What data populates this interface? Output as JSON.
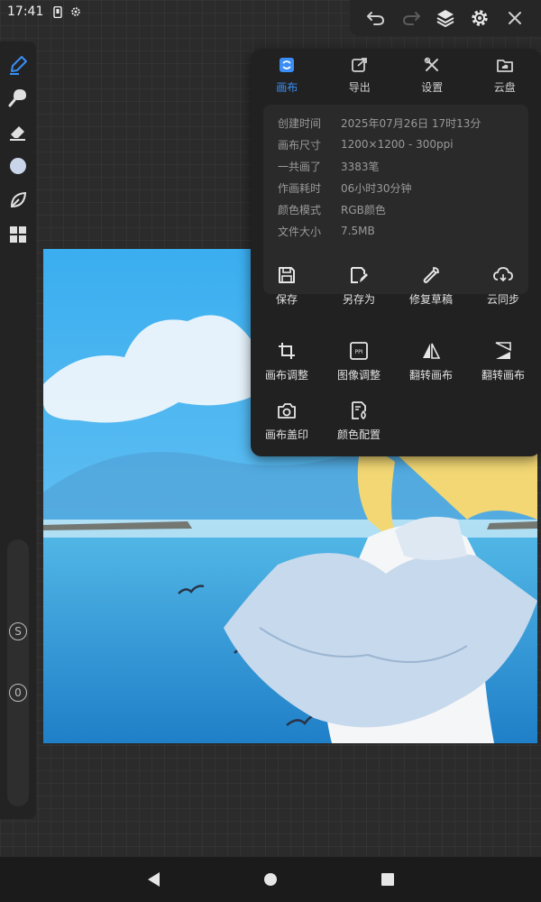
{
  "status": {
    "time": "17:41",
    "battery": "4%"
  },
  "colors": {
    "accent": "#3a8ef6",
    "panel_bg": "#212121",
    "info_bg": "#2a2a2a"
  },
  "topbar": {
    "icons": [
      "undo-icon",
      "redo-icon",
      "layers-icon",
      "settings-icon",
      "close-icon"
    ]
  },
  "left_tools": {
    "icons": [
      "pen-brush-icon",
      "smudge-icon",
      "eraser-icon",
      "color-circle-icon",
      "leaf-icon",
      "grid-icon"
    ],
    "size_label": "S",
    "opacity_label": "0"
  },
  "panel": {
    "tabs": [
      {
        "label": "画布",
        "icon": "canvas-icon",
        "active": true
      },
      {
        "label": "导出",
        "icon": "export-icon",
        "active": false
      },
      {
        "label": "设置",
        "icon": "tools-icon",
        "active": false
      },
      {
        "label": "云盘",
        "icon": "cloud-folder-icon",
        "active": false
      }
    ],
    "info": [
      {
        "label": "创建时间",
        "value": "2025年07月26日 17时13分"
      },
      {
        "label": "画布尺寸",
        "value": "1200×1200 - 300ppi"
      },
      {
        "label": "一共画了",
        "value": "3383笔"
      },
      {
        "label": "作画耗时",
        "value": "06小时30分钟"
      },
      {
        "label": "颜色模式",
        "value": "RGB颜色"
      },
      {
        "label": "文件大小",
        "value": "7.5MB"
      }
    ],
    "actions": [
      {
        "label": "保存",
        "icon": "save-icon"
      },
      {
        "label": "另存为",
        "icon": "save-as-icon"
      },
      {
        "label": "修复草稿",
        "icon": "wrench-icon"
      },
      {
        "label": "云同步",
        "icon": "cloud-sync-icon"
      },
      {
        "label": "画布调整",
        "icon": "crop-icon"
      },
      {
        "label": "图像调整",
        "icon": "ppi-icon"
      },
      {
        "label": "翻转画布",
        "icon": "flip-horizontal-icon"
      },
      {
        "label": "翻转画布",
        "icon": "flip-vertical-icon"
      },
      {
        "label": "画布盖印",
        "icon": "camera-stamp-icon"
      },
      {
        "label": "颜色配置",
        "icon": "color-profile-icon"
      }
    ]
  },
  "navbar": {
    "icons": [
      "back-icon",
      "home-icon",
      "recents-icon"
    ]
  }
}
